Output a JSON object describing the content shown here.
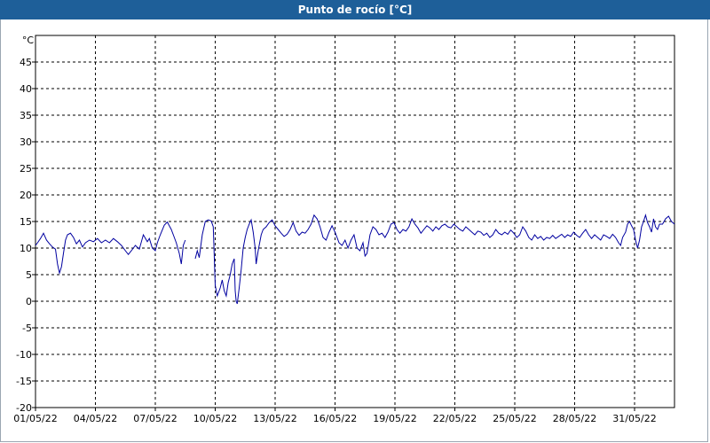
{
  "window": {
    "title": "Punto de rocío [°C]"
  },
  "chart_data": {
    "type": "line",
    "title": "Punto de rocío [°C]",
    "ylabel": "°C",
    "xlabel": "",
    "grid": true,
    "ylim": [
      -20,
      50
    ],
    "y_ticks": [
      "45",
      "40",
      "35",
      "30",
      "25",
      "20",
      "15",
      "10",
      "5",
      "0",
      "-5",
      "-10",
      "-15",
      "-20"
    ],
    "x_ticks": [
      "01/05/22",
      "04/05/22",
      "07/05/22",
      "10/05/22",
      "13/05/22",
      "16/05/22",
      "19/05/22",
      "22/05/22",
      "25/05/22",
      "28/05/22",
      "31/05/22"
    ],
    "x_range_days": [
      0,
      31
    ],
    "line_color": "#0000a0",
    "series": [
      {
        "name": "",
        "points": [
          [
            0.0,
            10.5
          ],
          [
            0.1,
            11.0
          ],
          [
            0.25,
            11.8
          ],
          [
            0.4,
            12.8
          ],
          [
            0.55,
            11.5
          ],
          [
            0.7,
            10.8
          ],
          [
            0.85,
            10.2
          ],
          [
            1.0,
            9.8
          ],
          [
            1.1,
            7.0
          ],
          [
            1.2,
            5.3
          ],
          [
            1.3,
            6.5
          ],
          [
            1.4,
            9.0
          ],
          [
            1.5,
            11.5
          ],
          [
            1.6,
            12.5
          ],
          [
            1.75,
            12.8
          ],
          [
            1.9,
            12.0
          ],
          [
            2.05,
            10.8
          ],
          [
            2.2,
            11.5
          ],
          [
            2.35,
            10.2
          ],
          [
            2.5,
            11.0
          ],
          [
            2.7,
            11.5
          ],
          [
            2.9,
            11.2
          ],
          [
            3.1,
            11.8
          ],
          [
            3.3,
            11.0
          ],
          [
            3.5,
            11.5
          ],
          [
            3.7,
            11.0
          ],
          [
            3.9,
            11.8
          ],
          [
            4.1,
            11.2
          ],
          [
            4.3,
            10.5
          ],
          [
            4.5,
            9.5
          ],
          [
            4.65,
            8.8
          ],
          [
            4.8,
            9.5
          ],
          [
            5.0,
            10.5
          ],
          [
            5.2,
            9.8
          ],
          [
            5.4,
            12.5
          ],
          [
            5.6,
            11.2
          ],
          [
            5.7,
            11.8
          ],
          [
            5.85,
            10.0
          ],
          [
            6.0,
            9.5
          ],
          [
            6.1,
            11.0
          ],
          [
            6.25,
            12.5
          ],
          [
            6.45,
            14.3
          ],
          [
            6.6,
            14.9
          ],
          [
            6.8,
            13.5
          ],
          [
            6.95,
            12.0
          ],
          [
            7.05,
            11.0
          ],
          [
            7.2,
            9.0
          ],
          [
            7.3,
            7.0
          ],
          [
            7.4,
            10.5
          ],
          [
            7.5,
            11.5
          ],
          [
            8.0,
            8.0
          ],
          [
            8.1,
            9.5
          ],
          [
            8.2,
            8.2
          ],
          [
            8.35,
            12.5
          ],
          [
            8.5,
            15.0
          ],
          [
            8.65,
            15.3
          ],
          [
            8.8,
            15.1
          ],
          [
            8.9,
            14.0
          ],
          [
            9.0,
            3.0
          ],
          [
            9.1,
            1.0
          ],
          [
            9.25,
            2.5
          ],
          [
            9.35,
            4.0
          ],
          [
            9.45,
            2.0
          ],
          [
            9.55,
            1.0
          ],
          [
            9.65,
            3.5
          ],
          [
            9.75,
            5.0
          ],
          [
            9.85,
            7.0
          ],
          [
            9.95,
            8.0
          ],
          [
            10.0,
            2.0
          ],
          [
            10.05,
            0.0
          ],
          [
            10.1,
            -0.5
          ],
          [
            10.2,
            2.5
          ],
          [
            10.3,
            6.0
          ],
          [
            10.4,
            10.0
          ],
          [
            10.5,
            12.0
          ],
          [
            10.6,
            13.5
          ],
          [
            10.7,
            14.5
          ],
          [
            10.8,
            15.3
          ],
          [
            10.9,
            13.0
          ],
          [
            11.0,
            10.0
          ],
          [
            11.05,
            7.0
          ],
          [
            11.15,
            9.5
          ],
          [
            11.3,
            12.5
          ],
          [
            11.4,
            13.5
          ],
          [
            11.55,
            14.0
          ],
          [
            11.7,
            14.8
          ],
          [
            11.85,
            15.3
          ],
          [
            12.0,
            14.2
          ],
          [
            12.15,
            13.5
          ],
          [
            12.3,
            12.8
          ],
          [
            12.45,
            12.2
          ],
          [
            12.6,
            12.6
          ],
          [
            12.75,
            13.5
          ],
          [
            12.9,
            14.8
          ],
          [
            13.05,
            13.2
          ],
          [
            13.2,
            12.4
          ],
          [
            13.35,
            13.0
          ],
          [
            13.5,
            12.8
          ],
          [
            13.65,
            13.5
          ],
          [
            13.8,
            14.5
          ],
          [
            13.95,
            16.2
          ],
          [
            14.1,
            15.5
          ],
          [
            14.25,
            14.0
          ],
          [
            14.4,
            12.0
          ],
          [
            14.55,
            11.5
          ],
          [
            14.7,
            13.0
          ],
          [
            14.85,
            14.2
          ],
          [
            15.0,
            13.0
          ],
          [
            15.2,
            11.0
          ],
          [
            15.35,
            10.5
          ],
          [
            15.5,
            11.5
          ],
          [
            15.65,
            10.0
          ],
          [
            15.8,
            11.5
          ],
          [
            15.95,
            12.5
          ],
          [
            16.1,
            10.0
          ],
          [
            16.25,
            9.5
          ],
          [
            16.4,
            11.0
          ],
          [
            16.5,
            8.5
          ],
          [
            16.6,
            9.0
          ],
          [
            16.75,
            12.5
          ],
          [
            16.9,
            14.0
          ],
          [
            17.05,
            13.5
          ],
          [
            17.2,
            12.5
          ],
          [
            17.35,
            12.8
          ],
          [
            17.5,
            12.0
          ],
          [
            17.65,
            13.0
          ],
          [
            17.8,
            14.5
          ],
          [
            17.95,
            14.8
          ],
          [
            18.1,
            13.5
          ],
          [
            18.25,
            12.8
          ],
          [
            18.4,
            13.5
          ],
          [
            18.55,
            13.2
          ],
          [
            18.7,
            14.0
          ],
          [
            18.85,
            15.5
          ],
          [
            19.0,
            14.5
          ],
          [
            19.15,
            13.8
          ],
          [
            19.3,
            12.8
          ],
          [
            19.45,
            13.5
          ],
          [
            19.6,
            14.2
          ],
          [
            19.75,
            13.8
          ],
          [
            19.9,
            13.2
          ],
          [
            20.05,
            14.0
          ],
          [
            20.2,
            13.5
          ],
          [
            20.35,
            14.2
          ],
          [
            20.5,
            14.5
          ],
          [
            20.65,
            14.0
          ],
          [
            20.8,
            13.8
          ],
          [
            20.95,
            14.5
          ],
          [
            21.1,
            14.0
          ],
          [
            21.25,
            13.5
          ],
          [
            21.4,
            13.2
          ],
          [
            21.55,
            14.0
          ],
          [
            21.7,
            13.5
          ],
          [
            21.85,
            13.0
          ],
          [
            22.0,
            12.5
          ],
          [
            22.15,
            13.2
          ],
          [
            22.3,
            13.0
          ],
          [
            22.45,
            12.4
          ],
          [
            22.6,
            12.8
          ],
          [
            22.75,
            12.0
          ],
          [
            22.9,
            12.5
          ],
          [
            23.05,
            13.5
          ],
          [
            23.2,
            12.8
          ],
          [
            23.35,
            12.5
          ],
          [
            23.5,
            13.0
          ],
          [
            23.65,
            12.6
          ],
          [
            23.8,
            13.4
          ],
          [
            23.95,
            12.8
          ],
          [
            24.1,
            12.0
          ],
          [
            24.25,
            12.5
          ],
          [
            24.4,
            14.0
          ],
          [
            24.55,
            13.2
          ],
          [
            24.7,
            12.0
          ],
          [
            24.85,
            11.5
          ],
          [
            25.0,
            12.5
          ],
          [
            25.15,
            11.8
          ],
          [
            25.3,
            12.2
          ],
          [
            25.45,
            11.5
          ],
          [
            25.6,
            12.0
          ],
          [
            25.75,
            11.8
          ],
          [
            25.9,
            12.4
          ],
          [
            26.05,
            11.8
          ],
          [
            26.2,
            12.2
          ],
          [
            26.35,
            12.6
          ],
          [
            26.5,
            12.0
          ],
          [
            26.65,
            12.5
          ],
          [
            26.8,
            12.2
          ],
          [
            26.95,
            13.0
          ],
          [
            27.1,
            12.4
          ],
          [
            27.25,
            12.0
          ],
          [
            27.4,
            12.8
          ],
          [
            27.55,
            13.5
          ],
          [
            27.7,
            12.5
          ],
          [
            27.85,
            11.8
          ],
          [
            28.0,
            12.5
          ],
          [
            28.15,
            12.0
          ],
          [
            28.3,
            11.5
          ],
          [
            28.45,
            12.5
          ],
          [
            28.6,
            12.2
          ],
          [
            28.75,
            11.8
          ],
          [
            28.9,
            12.6
          ],
          [
            29.05,
            12.0
          ],
          [
            29.2,
            11.0
          ],
          [
            29.3,
            10.5
          ],
          [
            29.4,
            12.0
          ],
          [
            29.55,
            13.0
          ],
          [
            29.65,
            14.5
          ],
          [
            29.75,
            15.0
          ],
          [
            29.85,
            14.2
          ],
          [
            29.95,
            13.5
          ],
          [
            30.05,
            11.5
          ],
          [
            30.15,
            10.0
          ],
          [
            30.25,
            11.5
          ],
          [
            30.35,
            14.0
          ],
          [
            30.45,
            15.0
          ],
          [
            30.55,
            16.2
          ],
          [
            30.65,
            14.8
          ],
          [
            30.75,
            14.0
          ],
          [
            30.85,
            13.0
          ],
          [
            30.95,
            15.5
          ],
          [
            31.05,
            14.0
          ],
          [
            31.15,
            13.5
          ],
          [
            31.25,
            14.5
          ],
          [
            31.4,
            14.5
          ],
          [
            31.55,
            15.5
          ],
          [
            31.7,
            16.0
          ],
          [
            31.85,
            15.0
          ],
          [
            32.0,
            14.5
          ]
        ]
      }
    ]
  }
}
